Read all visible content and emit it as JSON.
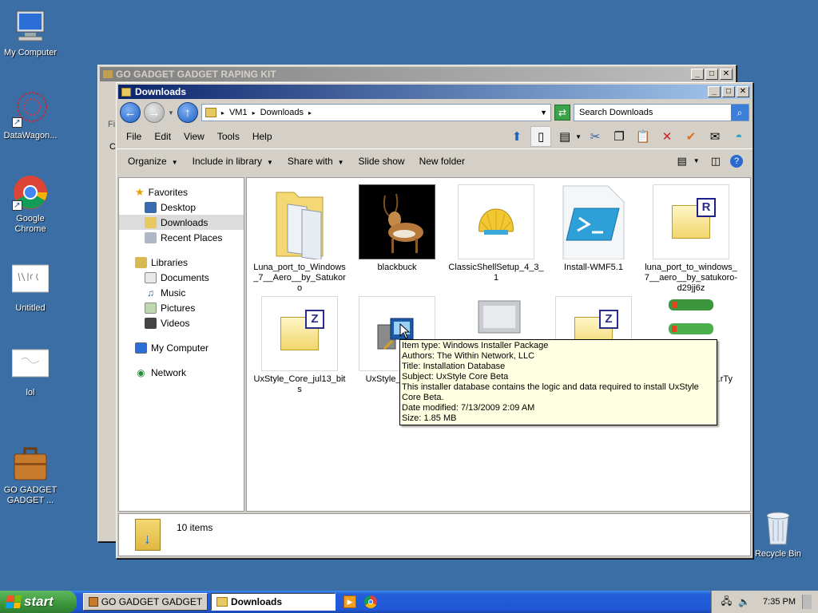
{
  "desktop": {
    "icons": [
      {
        "label": "My Computer"
      },
      {
        "label": "DataWagon..."
      },
      {
        "label": "Google Chrome"
      },
      {
        "label": "Untitled"
      },
      {
        "label": "lol"
      },
      {
        "label": "GO GADGET\nGADGET ..."
      },
      {
        "label": "Recycle Bin"
      }
    ]
  },
  "bg_window": {
    "title": "GO GADGET GADGET RAPING KIT",
    "frag1": "Fi",
    "frag2": "C"
  },
  "explorer": {
    "title": "Downloads",
    "breadcrumb": [
      "VM1",
      "Downloads"
    ],
    "search_placeholder": "Search Downloads",
    "menu": [
      "File",
      "Edit",
      "View",
      "Tools",
      "Help"
    ],
    "commands": [
      "Organize",
      "Include in library",
      "Share with",
      "Slide show",
      "New folder"
    ],
    "nav": {
      "favorites_label": "Favorites",
      "favorites": [
        "Desktop",
        "Downloads",
        "Recent Places"
      ],
      "libraries_label": "Libraries",
      "libraries": [
        "Documents",
        "Music",
        "Pictures",
        "Videos"
      ],
      "computer": "My Computer",
      "network": "Network"
    },
    "files": [
      {
        "name": "Luna_port_to_Windows_7__Aero__by_Satukoro"
      },
      {
        "name": "blackbuck"
      },
      {
        "name": "ClassicShellSetup_4_3_1"
      },
      {
        "name": "Install-WMF5.1"
      },
      {
        "name": "luna_port_to_windows_7__aero__by_satukoro-d29jj6z"
      },
      {
        "name": "UxStyle_Core_jul13_bits"
      },
      {
        "name": "UxStyle_C...3_x"
      },
      {
        "name": ""
      },
      {
        "name": ""
      },
      {
        "name": "...rTy"
      }
    ],
    "status_count": "10 items",
    "tooltip": {
      "type": "Item type: Windows Installer Package",
      "authors": "Authors: The Within Network, LLC",
      "title": "Title: Installation Database",
      "subject": "Subject: UxStyle Core Beta",
      "desc": "This installer database contains the logic and data required to install UxStyle Core Beta.",
      "modified": "Date modified: 7/13/2009 2:09 AM",
      "size": "Size: 1.85 MB"
    }
  },
  "taskbar": {
    "start": "start",
    "tasks": [
      "GO GADGET GADGET RA...",
      "Downloads"
    ],
    "clock": "7:35 PM"
  },
  "colors": {
    "desktop": "#3a6ea5",
    "taskbar": "#245edb",
    "start": "#3c963c",
    "tooltip": "#ffffe1"
  }
}
